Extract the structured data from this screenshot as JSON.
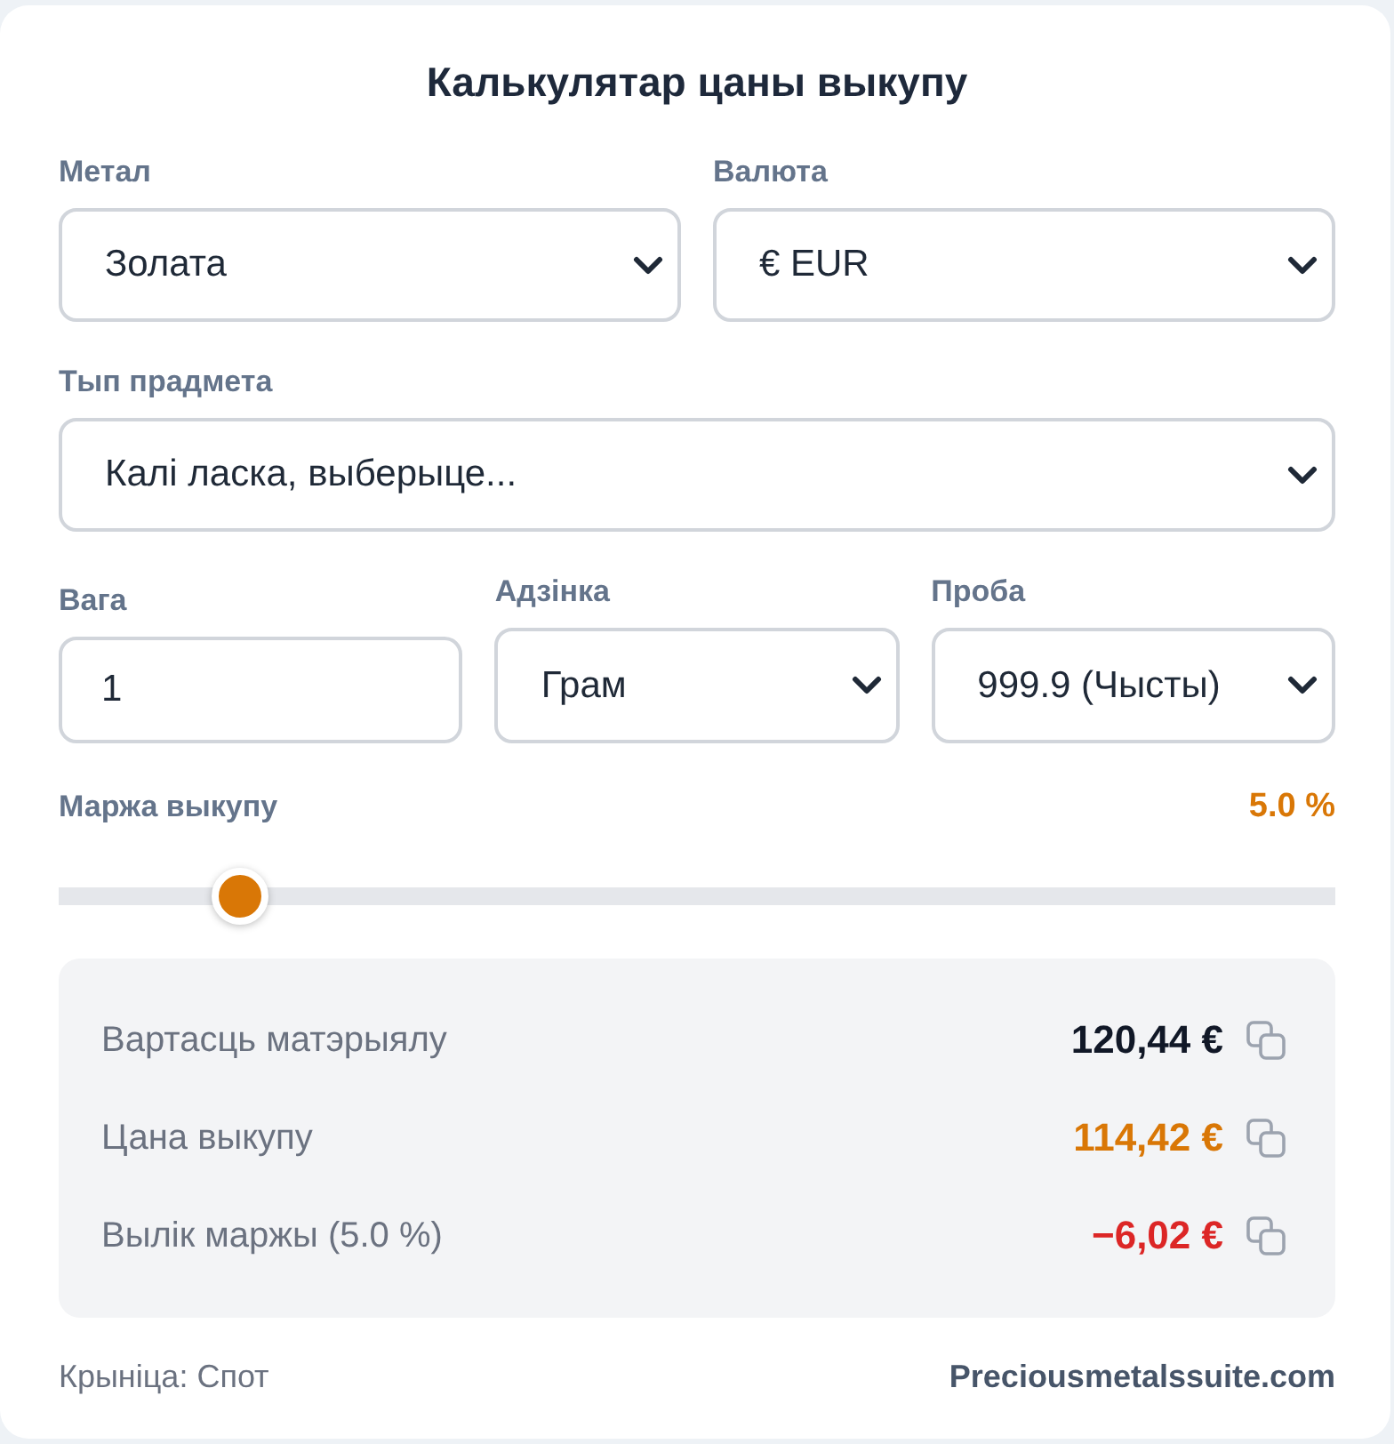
{
  "title": "Калькулятар цаны выкупу",
  "form_rows": [
    {
      "fields": [
        {
          "kind": "select",
          "label": "Метал",
          "value": "Золата"
        },
        {
          "kind": "select",
          "label": "Валюта",
          "value": "€ EUR"
        }
      ]
    },
    {
      "fields": [
        {
          "kind": "select",
          "label": "Тып прадмета",
          "placeholder": "Калі ласка, выберыце..."
        }
      ]
    },
    {
      "fields": [
        {
          "kind": "input",
          "label": "Вага",
          "value": "1"
        },
        {
          "kind": "select",
          "label": "Адзінка",
          "value": "Грам"
        },
        {
          "kind": "select",
          "label": "Проба",
          "value": "999.9 (Чысты)"
        }
      ]
    }
  ],
  "margin": {
    "label": "Маржа выкупу",
    "reading": "5.0 %",
    "level": 0.125
  },
  "results": [
    {
      "kind": "total",
      "label": "Вартасць матэрыялу",
      "value": "120,44 €"
    },
    {
      "kind": "payout",
      "label": "Цана выкупу",
      "value": "114,42 €"
    },
    {
      "kind": "deduction",
      "label": "Вылік маржы (5.0 %)",
      "value": "−6,02 €"
    }
  ],
  "footer": {
    "source": "Крыніца: Спот",
    "site": "Preciousmetalssuite.com"
  }
}
